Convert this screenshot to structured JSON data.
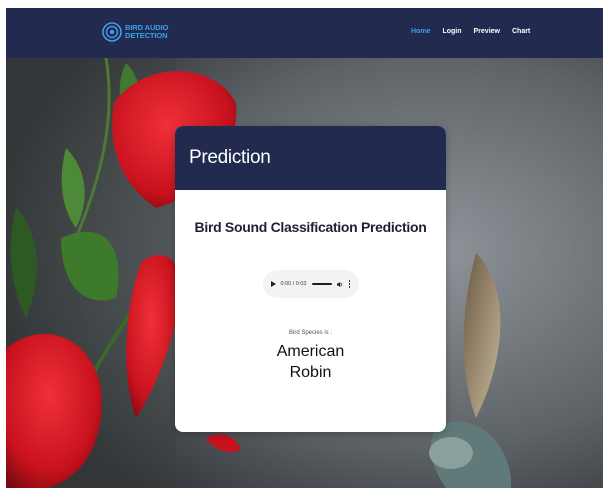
{
  "brand": {
    "line1": "BIRD AUDIO",
    "line2": "DETECTION",
    "logo_icon": "sound-wave-logo-icon"
  },
  "nav": {
    "items": [
      {
        "label": "Home",
        "active": true
      },
      {
        "label": "Login",
        "active": false
      },
      {
        "label": "Preview",
        "active": false
      },
      {
        "label": "Chart",
        "active": false
      }
    ]
  },
  "card": {
    "title": "Prediction",
    "subtitle": "Bird Sound Classification Prediction",
    "audio": {
      "time": "0:00 / 0:03",
      "icons": [
        "play-icon",
        "volume-icon",
        "more-options-icon"
      ]
    },
    "species_label": "Bird Species is :",
    "species_line1": "American",
    "species_line2": "Robin"
  },
  "colors": {
    "navbar": "#222a4f",
    "accent": "#3aa0e8",
    "card_bg": "#ffffff"
  }
}
